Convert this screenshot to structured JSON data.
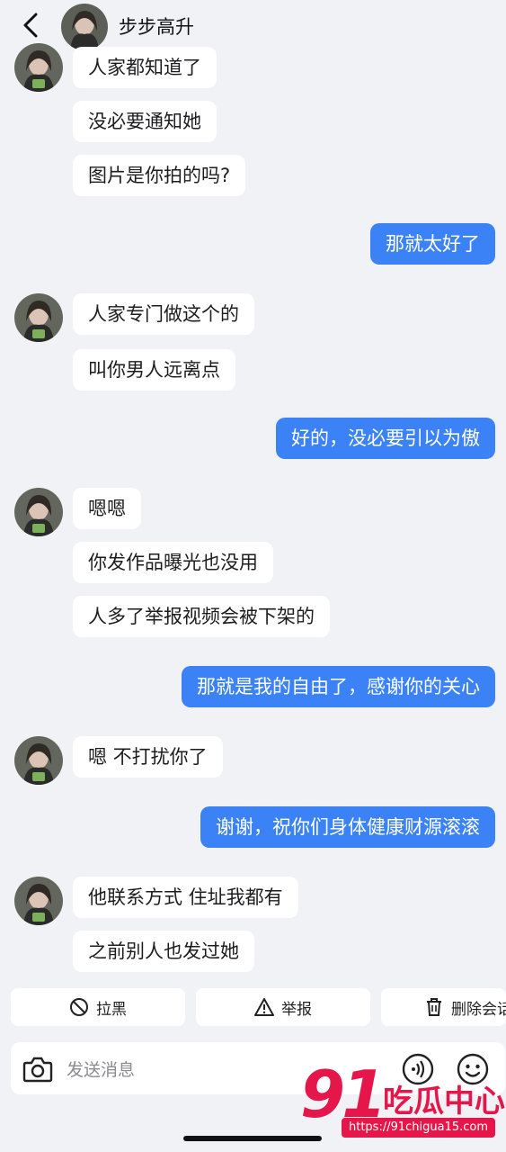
{
  "header": {
    "title": "步步高升"
  },
  "messages": [
    {
      "dir": "in",
      "text": "人家都知道了"
    },
    {
      "dir": "in",
      "text": "没必要通知她"
    },
    {
      "dir": "in",
      "text": "图片是你拍的吗?"
    },
    {
      "dir": "out",
      "text": "那就太好了"
    },
    {
      "dir": "in",
      "text": "人家专门做这个的"
    },
    {
      "dir": "in",
      "text": "叫你男人远离点"
    },
    {
      "dir": "out",
      "text": "好的，没必要引以为傲"
    },
    {
      "dir": "in",
      "text": "嗯嗯"
    },
    {
      "dir": "in",
      "text": "你发作品曝光也没用"
    },
    {
      "dir": "in",
      "text": "人多了举报视频会被下架的"
    },
    {
      "dir": "out",
      "text": "那就是我的自由了，感谢你的关心"
    },
    {
      "dir": "in",
      "text": "嗯 不打扰你了"
    },
    {
      "dir": "out",
      "text": "谢谢，祝你们身体健康财源滚滚"
    },
    {
      "dir": "in",
      "text": "他联系方式 住址我都有"
    },
    {
      "dir": "in",
      "text": "之前别人也发过她"
    }
  ],
  "actions": {
    "block": "拉黑",
    "report": "举报",
    "delete": "删除会话"
  },
  "composer": {
    "placeholder": "发送消息"
  },
  "watermark": {
    "number": "91",
    "name": "吃瓜中心",
    "url": "https://91chigua15.com"
  },
  "colors": {
    "outgoing": "#3b82f6",
    "incoming": "#ffffff",
    "background": "#f1f2f6",
    "watermark": "#e5174a"
  }
}
